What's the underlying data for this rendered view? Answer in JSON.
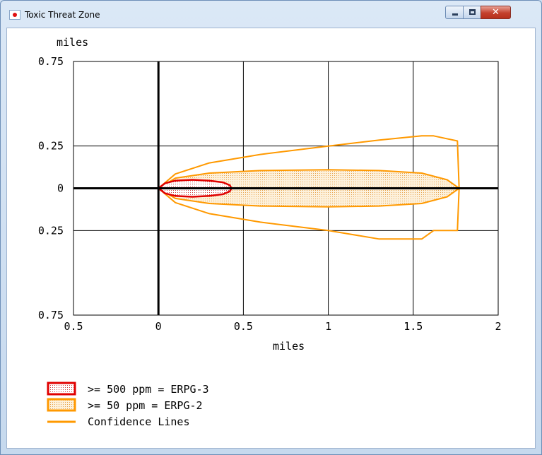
{
  "window": {
    "title": "Toxic Threat Zone",
    "close_glyph": "✕"
  },
  "chart_data": {
    "type": "area",
    "title": "",
    "xlabel": "miles",
    "ylabel": "miles",
    "xlim": [
      -0.5,
      2
    ],
    "ylim": [
      -0.75,
      0.75
    ],
    "x_ticks": [
      {
        "value": -0.5,
        "label": "0.5"
      },
      {
        "value": 0,
        "label": "0"
      },
      {
        "value": 0.5,
        "label": "0.5"
      },
      {
        "value": 1,
        "label": "1"
      },
      {
        "value": 1.5,
        "label": "1.5"
      },
      {
        "value": 2,
        "label": "2"
      }
    ],
    "y_ticks": [
      {
        "value": 0.75,
        "label": "0.75"
      },
      {
        "value": 0.25,
        "label": "0.25"
      },
      {
        "value": 0,
        "label": "0"
      },
      {
        "value": -0.25,
        "label": "0.25"
      },
      {
        "value": -0.75,
        "label": "0.75"
      }
    ],
    "grid": true,
    "legend_position": "bottom-left",
    "series": [
      {
        "name": ">= 500 ppm = ERPG-3",
        "kind": "filled-zone",
        "stroke": "#e00000",
        "fill": "#f7d8d8",
        "x": [
          0.0,
          0.04,
          0.1,
          0.2,
          0.3,
          0.38,
          0.42,
          0.43,
          0.42,
          0.38,
          0.3,
          0.2,
          0.1,
          0.04,
          0.0
        ],
        "y": [
          0.0,
          0.03,
          0.045,
          0.05,
          0.045,
          0.035,
          0.018,
          0.0,
          -0.018,
          -0.035,
          -0.045,
          -0.05,
          -0.045,
          -0.03,
          0.0
        ]
      },
      {
        "name": ">= 50 ppm = ERPG-2",
        "kind": "filled-zone",
        "stroke": "#ff9900",
        "fill": "#fde7c4",
        "x": [
          0.0,
          0.1,
          0.3,
          0.6,
          1.0,
          1.3,
          1.55,
          1.7,
          1.77,
          1.7,
          1.55,
          1.3,
          1.0,
          0.6,
          0.3,
          0.1,
          0.0
        ],
        "y": [
          0.0,
          0.06,
          0.09,
          0.105,
          0.11,
          0.105,
          0.09,
          0.05,
          0.0,
          -0.05,
          -0.09,
          -0.105,
          -0.11,
          -0.105,
          -0.09,
          -0.06,
          0.0
        ]
      },
      {
        "name": "Confidence Lines",
        "kind": "outline",
        "stroke": "#ff9900",
        "x": [
          0.0,
          0.1,
          0.3,
          0.6,
          1.0,
          1.3,
          1.55,
          1.62,
          1.76,
          1.77,
          1.76,
          1.62,
          1.55,
          1.3,
          1.0,
          0.6,
          0.3,
          0.1,
          0.0
        ],
        "y": [
          0.0,
          0.085,
          0.15,
          0.2,
          0.25,
          0.285,
          0.31,
          0.31,
          0.28,
          0.0,
          -0.25,
          -0.25,
          -0.3,
          -0.3,
          -0.25,
          -0.2,
          -0.15,
          -0.085,
          0.0
        ]
      }
    ]
  }
}
